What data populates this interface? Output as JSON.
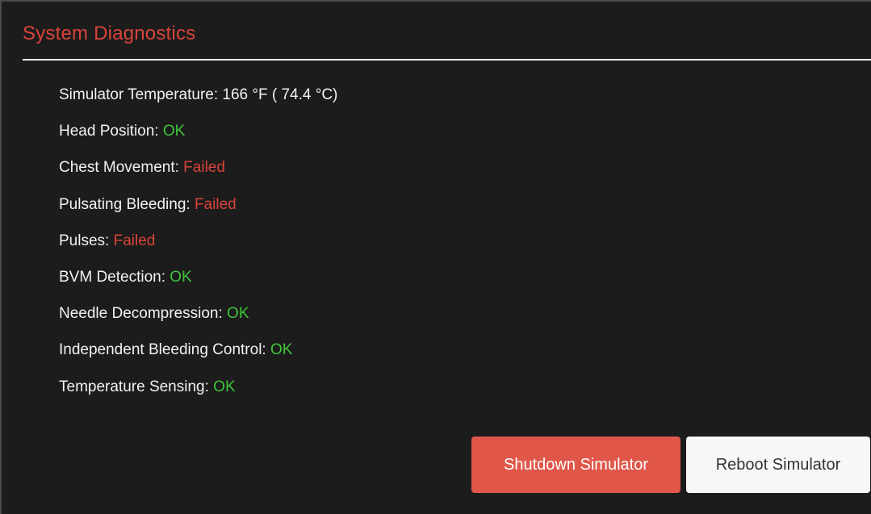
{
  "panel": {
    "title": "System Diagnostics"
  },
  "diagnostics": [
    {
      "label": "Simulator Temperature: ",
      "value": "166 °F ( 74.4 °C)",
      "status": "neutral"
    },
    {
      "label": "Head Position: ",
      "value": "OK",
      "status": "ok"
    },
    {
      "label": "Chest Movement: ",
      "value": "Failed",
      "status": "failed"
    },
    {
      "label": "Pulsating Bleeding: ",
      "value": "Failed",
      "status": "failed"
    },
    {
      "label": "Pulses: ",
      "value": "Failed",
      "status": "failed"
    },
    {
      "label": "BVM Detection: ",
      "value": "OK",
      "status": "ok"
    },
    {
      "label": "Needle Decompression: ",
      "value": "OK",
      "status": "ok"
    },
    {
      "label": "Independent Bleeding Control: ",
      "value": "OK",
      "status": "ok"
    },
    {
      "label": "Temperature Sensing: ",
      "value": "OK",
      "status": "ok"
    }
  ],
  "actions": {
    "shutdown_label": "Shutdown Simulator",
    "reboot_label": "Reboot Simulator"
  },
  "colors": {
    "title": "#d9443a",
    "ok": "#3ec53a",
    "failed": "#d9443a",
    "shutdown_button": "#e0574a",
    "reboot_button": "#f7f7f7",
    "background": "#1c1c1c"
  }
}
